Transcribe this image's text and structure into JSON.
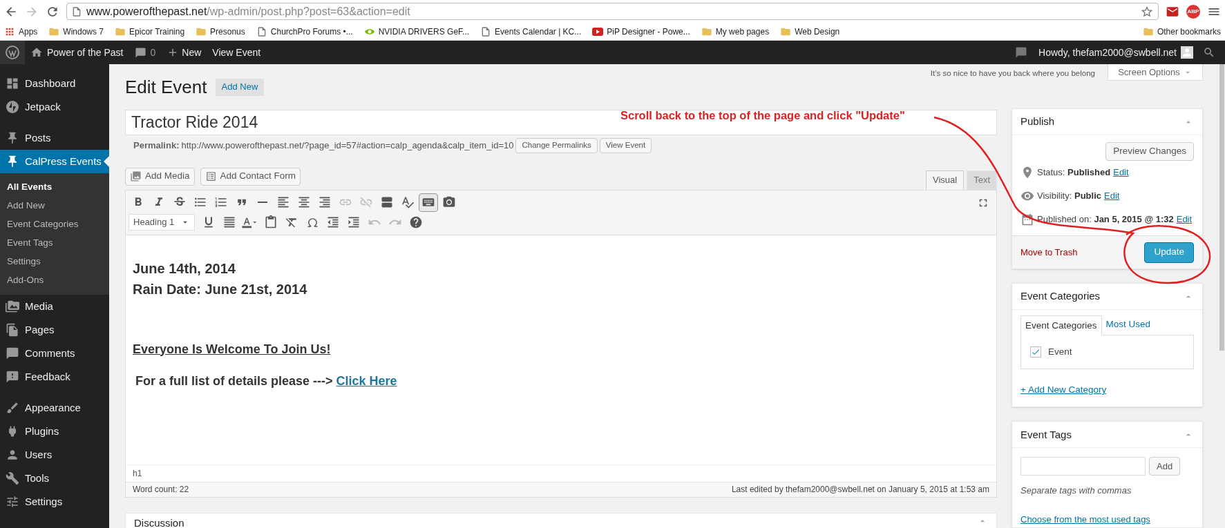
{
  "browser": {
    "back_disabled": false,
    "forward_disabled": true,
    "url_host": "www.powerofthepast.net",
    "url_path": "/wp-admin/post.php?post=63&action=edit",
    "extension_label": "ABP",
    "bookmarks": [
      {
        "kind": "apps",
        "label": "Apps"
      },
      {
        "kind": "folder",
        "label": "Windows 7"
      },
      {
        "kind": "folder",
        "label": "Epicor Training"
      },
      {
        "kind": "folder",
        "label": "Presonus"
      },
      {
        "kind": "page",
        "label": "ChurchPro Forums •..."
      },
      {
        "kind": "nvidia",
        "label": "NVIDIA DRIVERS GeF..."
      },
      {
        "kind": "page",
        "label": "Events Calendar | KC..."
      },
      {
        "kind": "video",
        "label": "PiP Designer - Powe..."
      },
      {
        "kind": "folder",
        "label": "My web pages"
      },
      {
        "kind": "folder",
        "label": "Web Design"
      }
    ],
    "other_bookmarks": "Other bookmarks"
  },
  "admin_bar": {
    "site": "Power of the Past",
    "comments": "0",
    "new": "New",
    "view": "View Event",
    "howdy": "Howdy, thefam2000@swbell.net"
  },
  "sidebar": {
    "groups": [
      [
        {
          "label": "Dashboard",
          "kind": "dashboard",
          "selected": false
        },
        {
          "label": "Jetpack",
          "kind": "jetpack",
          "selected": false
        }
      ],
      [
        {
          "label": "Posts",
          "kind": "pin",
          "selected": false
        },
        {
          "label": "CalPress Events",
          "kind": "pin",
          "selected": true,
          "children": [
            {
              "label": "All Events",
              "selected": true
            },
            {
              "label": "Add New",
              "selected": false
            },
            {
              "label": "Event Categories",
              "selected": false
            },
            {
              "label": "Event Tags",
              "selected": false
            },
            {
              "label": "Settings",
              "selected": false
            },
            {
              "label": "Add-Ons",
              "selected": false
            }
          ]
        },
        {
          "label": "Media",
          "kind": "media",
          "selected": false
        },
        {
          "label": "Pages",
          "kind": "pages",
          "selected": false
        },
        {
          "label": "Comments",
          "kind": "comments",
          "selected": false
        },
        {
          "label": "Feedback",
          "kind": "feedback",
          "selected": false
        }
      ],
      [
        {
          "label": "Appearance",
          "kind": "appearance",
          "selected": false
        },
        {
          "label": "Plugins",
          "kind": "plugins",
          "selected": false
        },
        {
          "label": "Users",
          "kind": "users",
          "selected": false
        },
        {
          "label": "Tools",
          "kind": "tools",
          "selected": false
        },
        {
          "label": "Settings",
          "kind": "settings",
          "selected": false
        }
      ]
    ]
  },
  "screen_meta": {
    "greeting": "It’s so nice to have you back where you belong",
    "screen_options": "Screen Options"
  },
  "page": {
    "title": "Edit Event",
    "add_new": "Add New",
    "post_title": "Tractor Ride 2014",
    "permalink_label": "Permalink:",
    "permalink": "http://www.powerofthepast.net/?page_id=57#action=calp_agenda&calp_item_id=10",
    "permalink_buttons": [
      "Change Permalinks",
      "View Event"
    ]
  },
  "annotation": {
    "text": "Scroll back to the top of the page and click \"Update\""
  },
  "editor": {
    "media_buttons": [
      {
        "kind": "media",
        "label": "Add Media"
      },
      {
        "kind": "form",
        "label": "Add Contact Form"
      }
    ],
    "tabs": [
      {
        "label": "Visual",
        "selected": true
      },
      {
        "label": "Text",
        "selected": false
      }
    ],
    "format": "Heading 1",
    "toolbar_1": [
      {
        "kind": "bold",
        "disabled": false,
        "pressed": false
      },
      {
        "kind": "italic",
        "disabled": false,
        "pressed": false
      },
      {
        "kind": "strike",
        "disabled": false,
        "pressed": false
      },
      {
        "kind": "bullets",
        "disabled": false,
        "pressed": false
      },
      {
        "kind": "numbers",
        "disabled": false,
        "pressed": false
      },
      {
        "kind": "quote",
        "disabled": false,
        "pressed": false
      },
      {
        "kind": "hr",
        "disabled": false,
        "pressed": false
      },
      {
        "kind": "left",
        "disabled": false,
        "pressed": false
      },
      {
        "kind": "center",
        "disabled": false,
        "pressed": false
      },
      {
        "kind": "right",
        "disabled": false,
        "pressed": false
      },
      {
        "kind": "link",
        "disabled": true,
        "pressed": false
      },
      {
        "kind": "unlink",
        "disabled": true,
        "pressed": false
      },
      {
        "kind": "more",
        "disabled": false,
        "pressed": false
      },
      {
        "kind": "spell",
        "disabled": false,
        "pressed": false
      },
      {
        "kind": "keyboard",
        "disabled": false,
        "pressed": true
      },
      {
        "kind": "camera",
        "disabled": false,
        "pressed": false
      }
    ],
    "toolbar_2": [
      {
        "kind": "underline",
        "disabled": false,
        "pressed": false
      },
      {
        "kind": "justify",
        "disabled": false,
        "pressed": false
      },
      {
        "kind": "color",
        "disabled": false,
        "pressed": false
      },
      {
        "kind": "paste",
        "disabled": false,
        "pressed": false
      },
      {
        "kind": "clear",
        "disabled": false,
        "pressed": false
      },
      {
        "kind": "omega",
        "disabled": false,
        "pressed": false
      },
      {
        "kind": "outdent",
        "disabled": false,
        "pressed": false
      },
      {
        "kind": "indent",
        "disabled": false,
        "pressed": false
      },
      {
        "kind": "undo",
        "disabled": true,
        "pressed": false
      },
      {
        "kind": "redo",
        "disabled": true,
        "pressed": false
      },
      {
        "kind": "help",
        "disabled": false,
        "pressed": false
      }
    ],
    "content": [
      {
        "kind": "heading",
        "text": "June 14th, 2014"
      },
      {
        "kind": "heading",
        "text": "Rain Date: June 21st, 2014"
      },
      {
        "kind": "underlined",
        "text": "Everyone Is Welcome To Join Us!"
      },
      {
        "kind": "link_line",
        "text": "For a full list of details please --->",
        "link": "Click Here"
      }
    ],
    "path": "h1",
    "word_count": "Word count: 22",
    "last_edited": "Last edited by thefam2000@swbell.net on January 5, 2015 at 1:53 am"
  },
  "discussion": {
    "title": "Discussion"
  },
  "publish": {
    "title": "Publish",
    "preview": "Preview Changes",
    "rows": [
      {
        "kind": "status",
        "label": "Status:",
        "value": "Published",
        "edit": "Edit"
      },
      {
        "kind": "visibility",
        "label": "Visibility:",
        "value": "Public",
        "edit": "Edit"
      },
      {
        "kind": "date",
        "label": "Published on:",
        "value": "Jan 5, 2015 @ 1:32",
        "edit": "Edit"
      }
    ],
    "trash": "Move to Trash",
    "update": "Update"
  },
  "categories": {
    "title": "Event Categories",
    "tabs": [
      {
        "label": "Event Categories",
        "selected": true
      },
      {
        "label": "Most Used",
        "selected": false
      }
    ],
    "items": [
      {
        "label": "Event",
        "checked": true
      }
    ],
    "add_new": "+ Add New Category"
  },
  "tags": {
    "title": "Event Tags",
    "add": "Add",
    "hint": "Separate tags with commas",
    "choose": "Choose from the most used tags"
  }
}
